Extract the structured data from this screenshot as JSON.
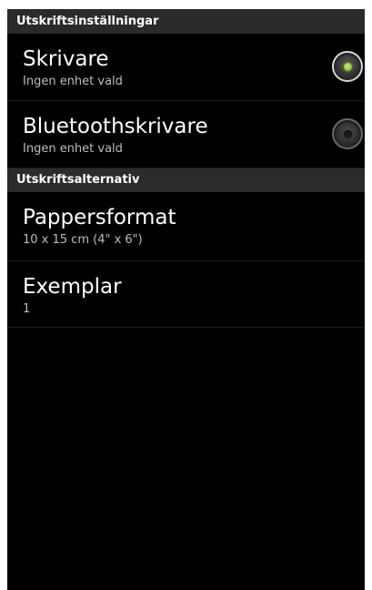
{
  "sections": [
    {
      "header": "Utskriftsinställningar",
      "items": [
        {
          "title": "Skrivare",
          "subtitle": "Ingen enhet vald",
          "radio_checked": true
        },
        {
          "title": "Bluetoothskrivare",
          "subtitle": "Ingen enhet vald",
          "radio_checked": false
        }
      ]
    },
    {
      "header": "Utskriftsalternativ",
      "items": [
        {
          "title": "Pappersformat",
          "subtitle": "10 x 15 cm (4\" x 6\")"
        },
        {
          "title": "Exemplar",
          "subtitle": "1"
        }
      ]
    }
  ],
  "colors": {
    "background": "#000000",
    "header_background": "#2a2a2a",
    "radio_accent": "#8cc63f"
  },
  "icons": {
    "selected": "radio-selected-icon",
    "unselected": "radio-unselected-icon"
  }
}
